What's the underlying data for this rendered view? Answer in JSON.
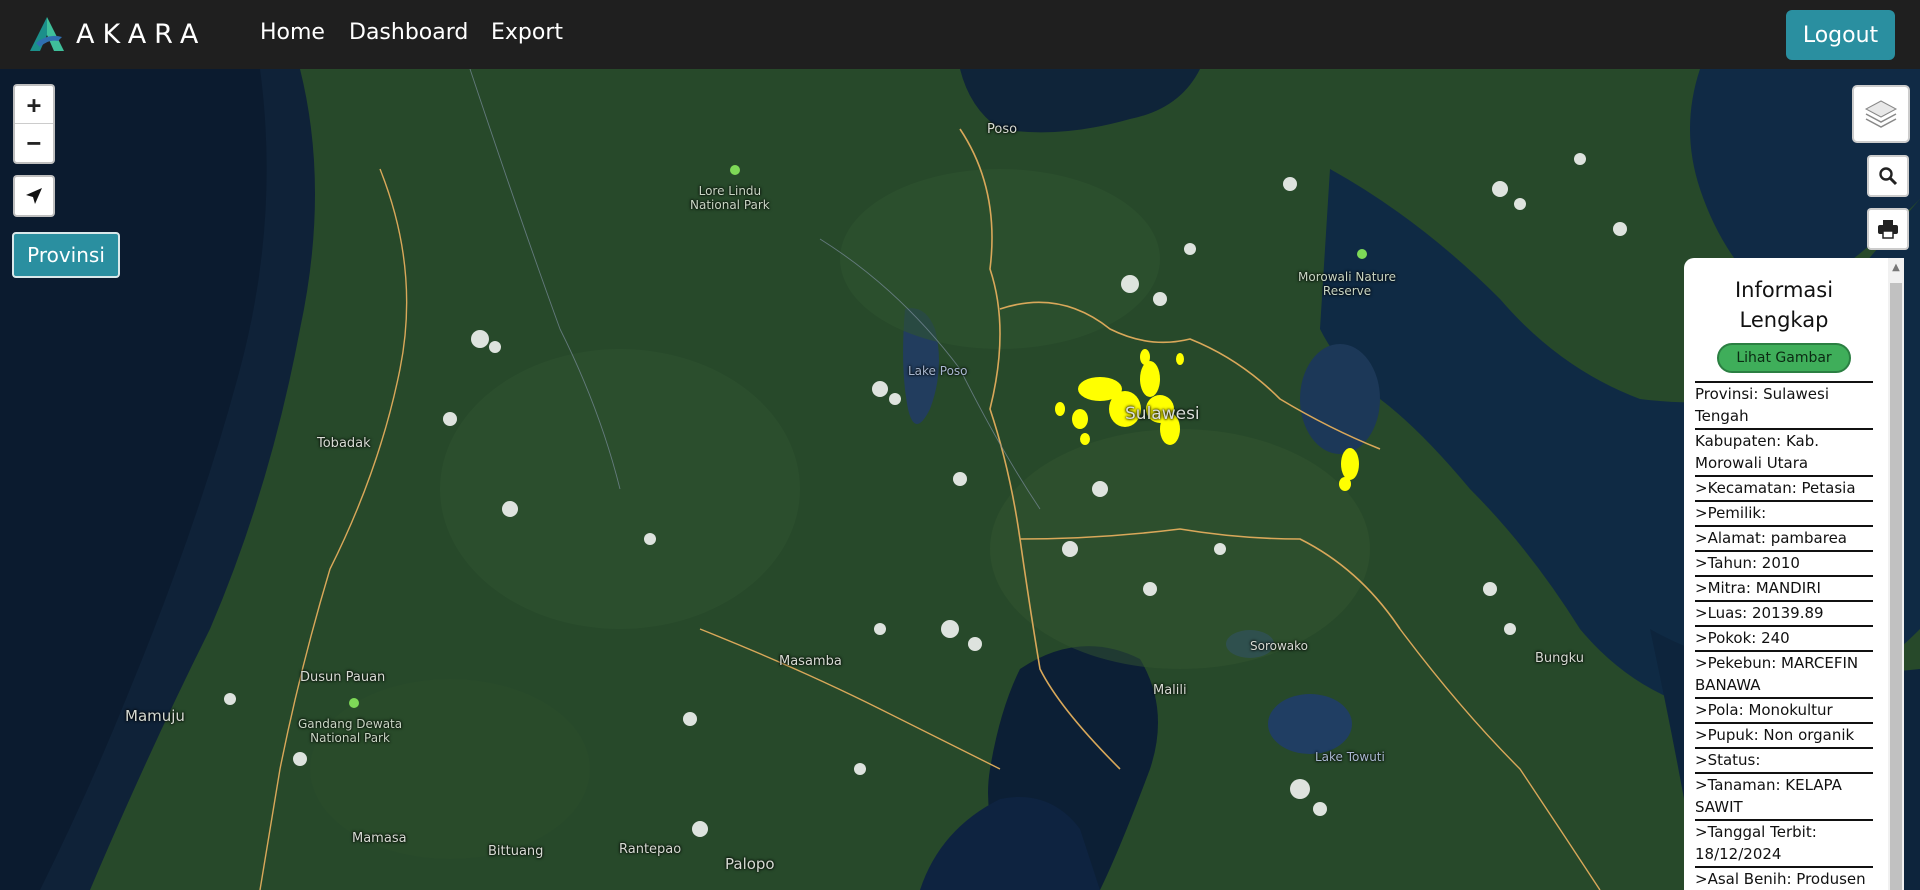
{
  "navbar": {
    "brand": "AKARA",
    "links": [
      "Home",
      "Dashboard",
      "Export"
    ],
    "logout_label": "Logout"
  },
  "map": {
    "controls": {
      "zoom_in": "+",
      "zoom_out": "−",
      "provinsi_label": "Provinsi"
    },
    "labels": {
      "poso": "Poso",
      "lore_lindu": "Lore Lindu\nNational Park",
      "morowali": "Morowali Nature\nReserve",
      "lake_poso": "Lake Poso",
      "sulawesi": "Sulawesi",
      "tobadak": "Tobadak",
      "masamba": "Masamba",
      "malili": "Malili",
      "sorowako": "Sorowako",
      "bungku": "Bungku",
      "dusun_pauan": "Dusun Pauan",
      "mamuju": "Mamuju",
      "gandang_dewata": "Gandang Dewata\nNational Park",
      "lake_towuti": "Lake Towuti",
      "mamasa": "Mamasa",
      "bittuang": "Bittuang",
      "rantepao": "Rantepao",
      "palopo": "Palopo"
    },
    "colors": {
      "plot_highlight": "#ffff00",
      "boundary": "#d9a85a"
    }
  },
  "info": {
    "title": "Informasi Lengkap",
    "button": "Lihat Gambar",
    "rows": [
      "Provinsi: Sulawesi Tengah",
      "Kabupaten: Kab. Morowali Utara",
      ">Kecamatan: Petasia",
      ">Pemilik:",
      ">Alamat: pambarea",
      ">Tahun: 2010",
      ">Mitra: MANDIRI",
      ">Luas: 20139.89",
      ">Pokok: 240",
      ">Pekebun: MARCEFIN BANAWA",
      ">Pola: Monokultur",
      ">Pupuk: Non organik",
      ">Status:",
      ">Tanaman: KELAPA SAWIT",
      ">Tanggal Terbit: 18/12/2024",
      ">Asal Benih: Produsen"
    ]
  }
}
